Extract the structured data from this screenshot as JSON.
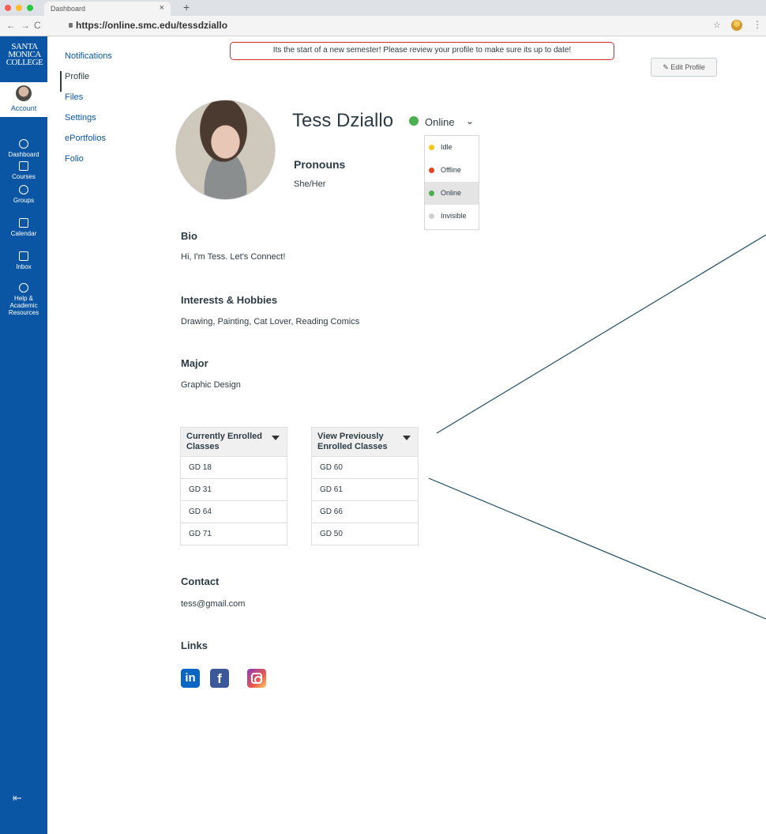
{
  "browser": {
    "tab_title": "Dashboard",
    "tab_close": "×",
    "new_tab": "+",
    "back": "←",
    "forward": "→",
    "reload": "C",
    "url": "https://online.smc.edu/tessdziallo",
    "star": "☆",
    "menu": "⋮"
  },
  "global_nav": {
    "logo_line1": "SANTA",
    "logo_line2": "MONICA",
    "logo_line3": "COLLEGE",
    "account": "Account",
    "items": [
      {
        "label": "Dashboard",
        "icon": "dashboard-icon"
      },
      {
        "label": "Courses",
        "icon": "courses-icon"
      },
      {
        "label": "Groups",
        "icon": "groups-icon"
      },
      {
        "label": "Calendar",
        "icon": "calendar-icon"
      },
      {
        "label": "Inbox",
        "icon": "inbox-icon"
      },
      {
        "label": "Help & Academic Resources",
        "icon": "help-icon"
      }
    ],
    "collapse": "⇤"
  },
  "sub_nav": [
    "Notifications",
    "Profile",
    "Files",
    "Settings",
    "ePortfolios",
    "Folio"
  ],
  "banner": "Its the start of a new semester! Please review your profile to make sure its up to date!",
  "edit_button": "Edit Profile",
  "profile": {
    "name": "Tess Dziallo",
    "status": "Online",
    "status_options": [
      {
        "label": "Idle",
        "color": "#f5c518"
      },
      {
        "label": "Offline",
        "color": "#e8431e"
      },
      {
        "label": "Online",
        "color": "#4caf50"
      },
      {
        "label": "Invisible",
        "color": "#d0d0d0"
      }
    ],
    "pronouns_heading": "Pronouns",
    "pronouns": "She/Her",
    "bio_heading": "Bio",
    "bio": "Hi, I'm Tess. Let's Connect!",
    "interests_heading": "Interests & Hobbies",
    "interests": "Drawing, Painting, Cat Lover, Reading Comics",
    "major_heading": "Major",
    "major": "Graphic Design",
    "current_classes_heading": "Currently Enrolled Classes",
    "current_classes": [
      "GD 18",
      "GD 31",
      "GD 64",
      "GD 71"
    ],
    "previous_classes_heading": "View Previously Enrolled Classes",
    "previous_classes": [
      "GD 60",
      "GD 61",
      "GD 66",
      "GD 50"
    ],
    "contact_heading": "Contact",
    "contact": "tess@gmail.com",
    "links_heading": "Links",
    "links": [
      {
        "name": "linkedin",
        "glyph": "in"
      },
      {
        "name": "facebook",
        "glyph": "f"
      },
      {
        "name": "instagram",
        "glyph": ""
      }
    ]
  },
  "colors": {
    "brand": "#0b56a4",
    "background": "#2d5b80",
    "banner_border": "#d02c2c",
    "annotation_line": "#1f4e67"
  }
}
